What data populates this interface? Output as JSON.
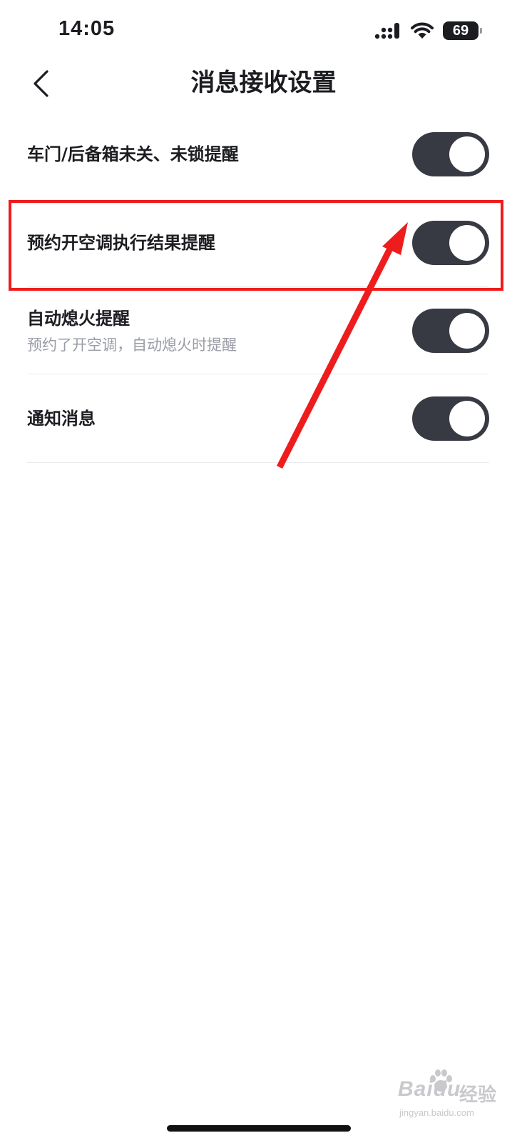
{
  "status_bar": {
    "time": "14:05",
    "battery": "69",
    "signal_icon": "cellular-signal-icon",
    "wifi_icon": "wifi-icon"
  },
  "nav": {
    "title": "消息接收设置",
    "back_icon": "chevron-left-icon"
  },
  "settings": [
    {
      "label": "车门/后备箱未关、未锁提醒",
      "description": "",
      "enabled": true
    },
    {
      "label": "预约开空调执行结果提醒",
      "description": "",
      "enabled": true
    },
    {
      "label": "自动熄火提醒",
      "description": "预约了开空调，自动熄火时提醒",
      "enabled": true
    },
    {
      "label": "通知消息",
      "description": "",
      "enabled": true
    }
  ],
  "annotation": {
    "color": "#ee1c1c"
  },
  "watermark": {
    "brand": "Bai",
    "brand_suffix": "du",
    "name": "经验",
    "url": "jingyan.baidu.com"
  },
  "colors": {
    "toggle_on": "#383a43",
    "description": "#9a9ca6"
  }
}
